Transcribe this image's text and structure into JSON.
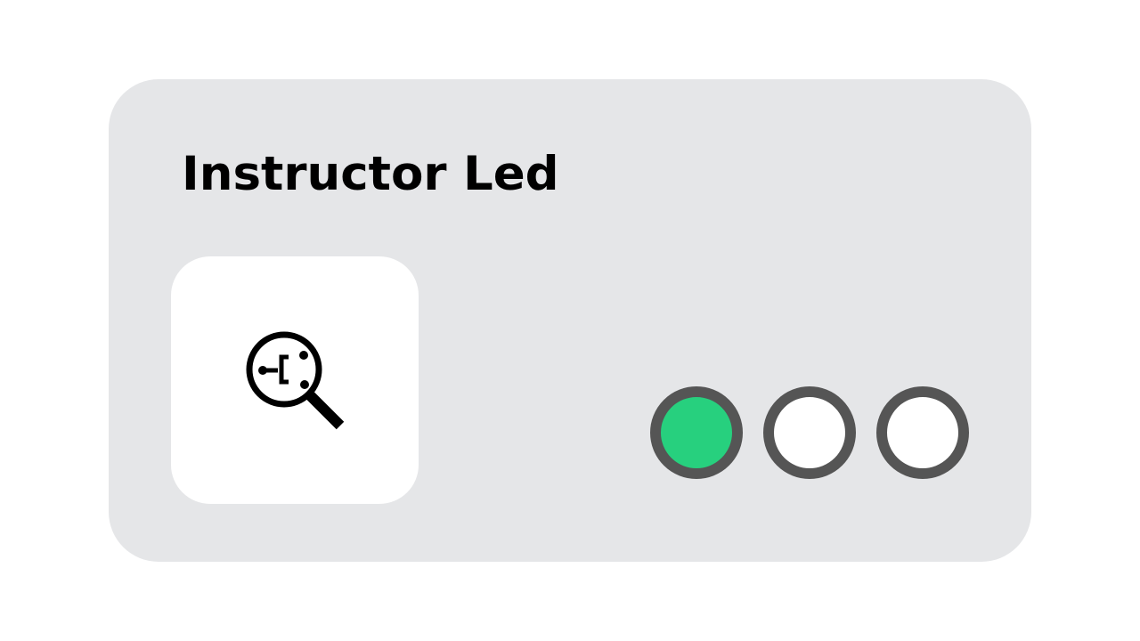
{
  "card": {
    "title": "Instructor Led",
    "icon": "magnifier-network-icon"
  },
  "progress": {
    "total_steps": 3,
    "current_step": 1,
    "steps": [
      {
        "state": "active",
        "color": "#27d07e"
      },
      {
        "state": "inactive",
        "color": "#ffffff"
      },
      {
        "state": "inactive",
        "color": "#ffffff"
      }
    ]
  },
  "colors": {
    "card_background": "#e5e6e8",
    "dot_border": "#555555",
    "active": "#27d07e"
  }
}
